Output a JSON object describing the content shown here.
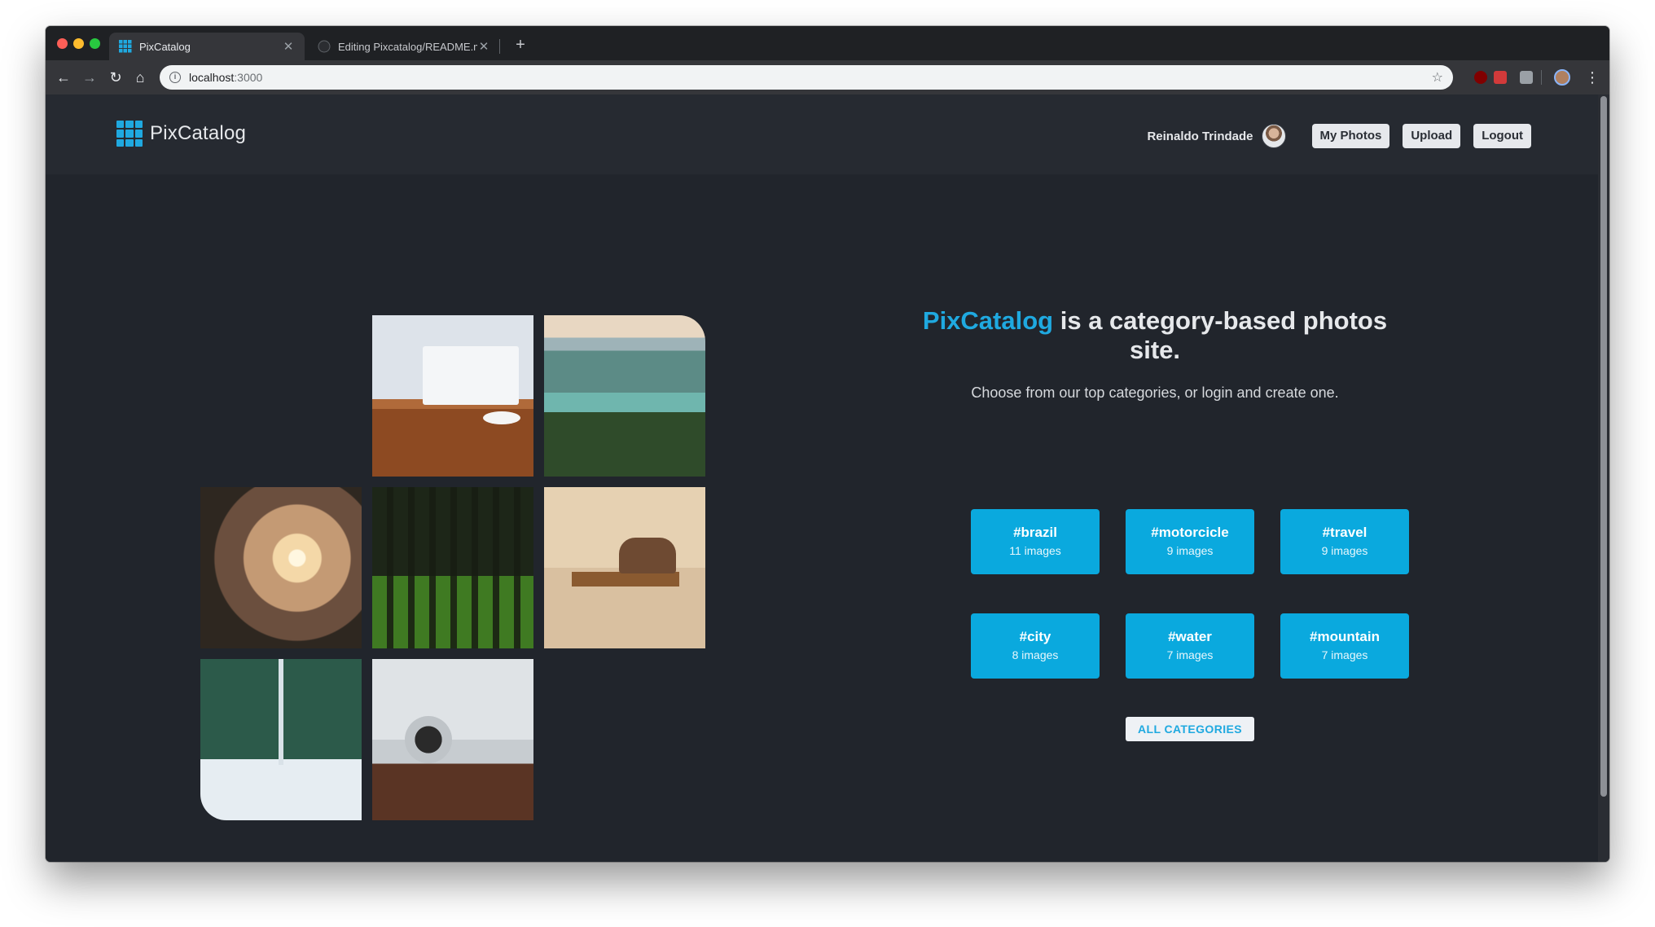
{
  "browser": {
    "tabs": [
      {
        "title": "PixCatalog",
        "active": true
      },
      {
        "title": "Editing Pixcatalog/README.md",
        "active": false
      }
    ],
    "url": {
      "host": "localhost",
      "port": ":3000"
    },
    "icons": {
      "back": "arrow-left-icon",
      "forward": "arrow-right-icon",
      "reload": "reload-icon",
      "home": "home-icon",
      "info": "info-icon",
      "bookmark": "star-icon",
      "menu": "kebab-menu-icon"
    }
  },
  "site": {
    "brand": "PixCatalog",
    "accent_color": "#1fa9e0",
    "background_color": "#21252c",
    "header": {
      "user_name": "Reinaldo Trindade",
      "buttons": {
        "my_photos": "My Photos",
        "upload": "Upload",
        "logout": "Logout"
      }
    },
    "hero": {
      "brand": "PixCatalog",
      "title_rest": " is a category-based photos site.",
      "subtitle": "Choose from our top categories, or login and create one."
    },
    "categories": [
      {
        "name": "#brazil",
        "count": "11 images"
      },
      {
        "name": "#motorcicle",
        "count": "9 images"
      },
      {
        "name": "#travel",
        "count": "9 images"
      },
      {
        "name": "#city",
        "count": "8 images"
      },
      {
        "name": "#water",
        "count": "7 images"
      },
      {
        "name": "#mountain",
        "count": "7 images"
      }
    ],
    "category_color": "#0aa9de",
    "all_categories_label": "ALL CATEGORIES",
    "photos": [
      "desk-laptop-photo",
      "lake-mountains-photo",
      "mountain-sunset-photo",
      "forest-photo",
      "couple-bench-photo",
      "bridge-underside-photo",
      "speaker-desk-photo"
    ]
  }
}
